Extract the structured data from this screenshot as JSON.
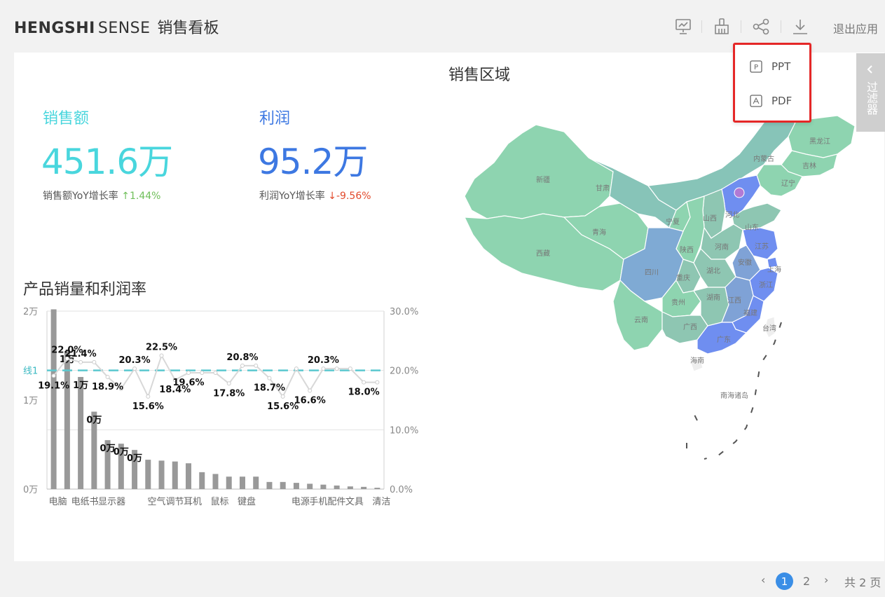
{
  "header": {
    "brand_bold": "HENGSHI",
    "brand_light": "SENSE",
    "dashboard_title": "销售看板",
    "exit_label": "退出应用"
  },
  "colors": {
    "accent_cyan": "#49d6dd",
    "accent_blue": "#3d78e2",
    "up": "#6fbf5a",
    "down": "#e24a2c",
    "bar": "#999999",
    "highlight": "#e52727"
  },
  "export_menu": {
    "items": [
      {
        "icon": "ppt-icon",
        "label": "PPT"
      },
      {
        "icon": "pdf-icon",
        "label": "PDF"
      }
    ]
  },
  "filter_panel": {
    "label": "过滤器"
  },
  "kpis": {
    "sales": {
      "label": "销售额",
      "value": "451.6万",
      "yoy_label": "销售额YoY增长率",
      "yoy_value": "1.44%",
      "direction": "up"
    },
    "profit": {
      "label": "利润",
      "value": "95.2万",
      "yoy_label": "利润YoY增长率",
      "yoy_value": "-9.56%",
      "direction": "down"
    }
  },
  "map": {
    "title": "销售区域",
    "regions": [
      "新疆",
      "西藏",
      "甘肃",
      "青海",
      "内蒙古",
      "黑龙江",
      "吉林",
      "辽宁",
      "宁夏",
      "山西",
      "河北",
      "山东",
      "陕西",
      "河南",
      "江苏",
      "安徽",
      "上海",
      "四川",
      "重庆",
      "湖北",
      "浙江",
      "贵州",
      "湖南",
      "江西",
      "福建",
      "云南",
      "广西",
      "广东",
      "台湾",
      "海南",
      "南海诸岛"
    ]
  },
  "chart_data": {
    "type": "bar",
    "title": "产品销量和利润率",
    "categories": [
      "电脑",
      "",
      "电纸书",
      "",
      "显示器",
      "",
      "",
      "",
      "空气调节",
      "",
      "耳机",
      "",
      "鼠标",
      "",
      "键盘",
      "",
      "",
      "",
      "电源",
      "",
      "手机配件",
      "",
      "文具",
      "",
      "清洁"
    ],
    "series": [
      {
        "type": "bar",
        "axis": "left",
        "values": [
          20200,
          15500,
          12600,
          8700,
          5500,
          5100,
          4400,
          3300,
          3200,
          3100,
          2900,
          1900,
          1700,
          1400,
          1400,
          1400,
          800,
          800,
          700,
          600,
          500,
          400,
          300,
          250,
          150
        ]
      },
      {
        "type": "line",
        "axis": "right",
        "values": [
          19.1,
          22.0,
          21.4,
          21.4,
          18.9,
          16.9,
          20.3,
          15.6,
          22.5,
          18.4,
          19.6,
          19.6,
          19.6,
          17.8,
          20.8,
          20.8,
          18.7,
          15.6,
          20.3,
          16.6,
          20.3,
          20.3,
          20.3,
          18.0,
          18.0
        ]
      }
    ],
    "data_labels_bar": [
      "",
      "1万",
      "1万",
      "0万",
      "0万",
      "0万",
      "0万"
    ],
    "data_labels_line": [
      "19.1%",
      "22.0%",
      "21.4%",
      "",
      "18.9%",
      "",
      "20.3%",
      "15.6%",
      "22.5%",
      "18.4%",
      "19.6%",
      "",
      "",
      "17.8%",
      "20.8%",
      "",
      "18.7%",
      "15.6%",
      "",
      "16.6%",
      "20.3%",
      "",
      "",
      "18.0%",
      ""
    ],
    "y_left": {
      "ticks": [
        "0万",
        "1万",
        "2万"
      ],
      "ylim": [
        0,
        20000
      ]
    },
    "y_right": {
      "ticks": [
        "0.0%",
        "10.0%",
        "20.0%",
        "30.0%"
      ],
      "ylim": [
        0,
        30
      ]
    },
    "reference_line": {
      "value": 20,
      "label": "线1"
    },
    "grid": true
  },
  "pagination": {
    "current": "1",
    "next": "2",
    "total_label": "共 2 页"
  }
}
